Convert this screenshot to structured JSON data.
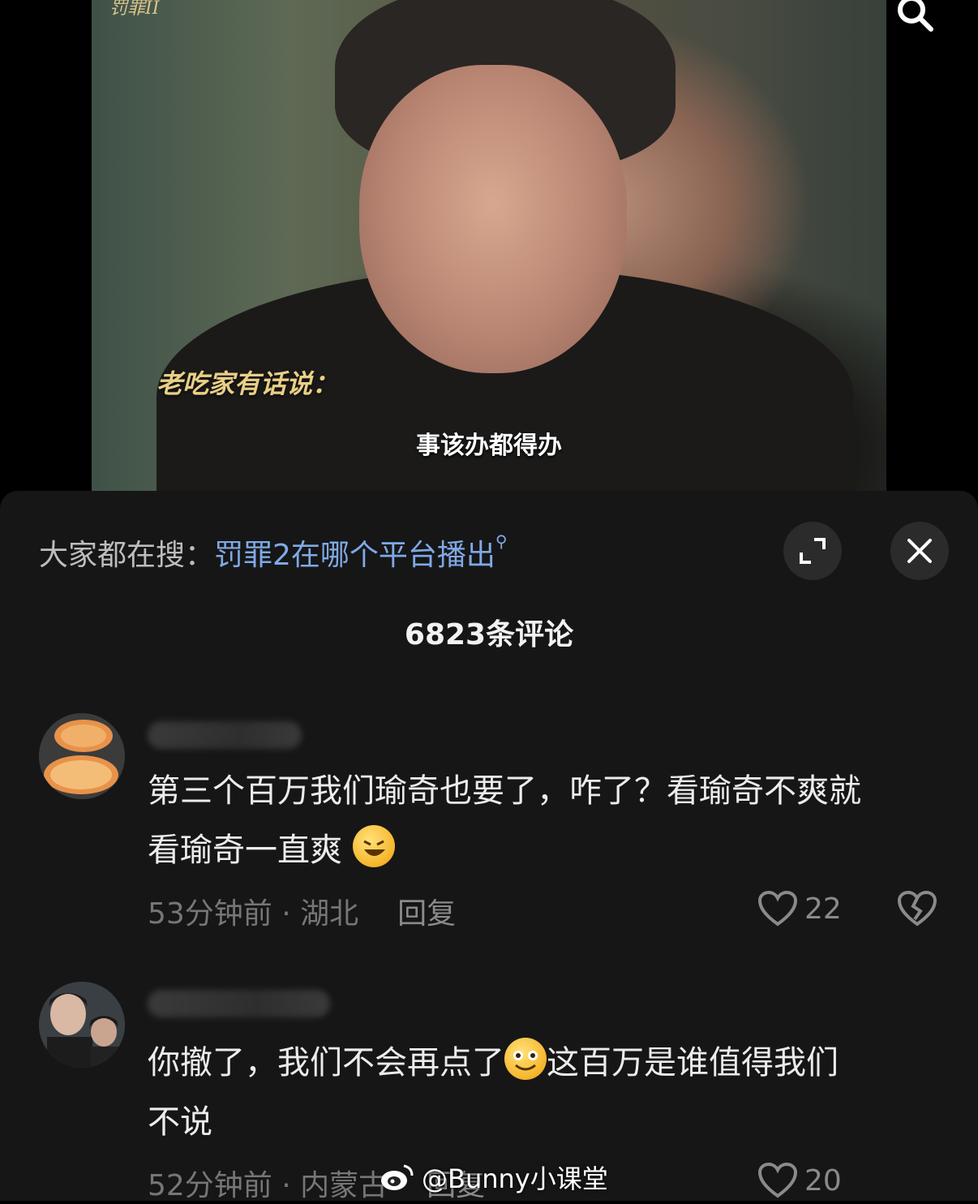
{
  "video": {
    "logo_text": "罚罪II",
    "caption_gold": "老吃家有话说：",
    "subtitle": "事该办都得办"
  },
  "sheet": {
    "hot_search_prefix": "大家都在搜：",
    "hot_search_query": "罚罪2在哪个平台播出",
    "comment_count": "6823条评论"
  },
  "comments": [
    {
      "text_line1": "第三个百万我们瑜奇也要了，咋了？看瑜奇不爽就",
      "text_line2": "看瑜奇一直爽",
      "emoji": "rofl-emoji",
      "time_loc": "53分钟前 · 湖北",
      "reply": "回复",
      "likes": "22"
    },
    {
      "text_line1_a": "你撤了，我们不会再点了",
      "text_line1_b": "这百万是谁值得我们",
      "text_line2": "不说",
      "emoji": "grin-emoji",
      "time_loc": "52分钟前 · 内蒙古",
      "reply": "回复",
      "likes": "20"
    }
  ],
  "watermark": {
    "text": "@Bunny小课堂"
  },
  "colors": {
    "sheet_bg": "#161616",
    "link_blue": "#7fa9e6",
    "meta_gray": "#767676"
  }
}
